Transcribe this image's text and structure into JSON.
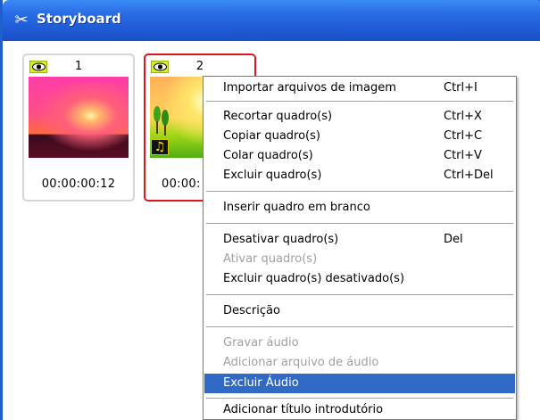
{
  "window": {
    "title": "Storyboard",
    "title_icon": "scissors-icon"
  },
  "frames": [
    {
      "number": "1",
      "time": "00:00:00:12",
      "selected": false,
      "has_audio": false
    },
    {
      "number": "2",
      "time": "00:00:",
      "selected": true,
      "has_audio": true
    }
  ],
  "menu": {
    "items": [
      {
        "label": "Importar arquivos de imagem",
        "shortcut": "Ctrl+I",
        "disabled": false,
        "highlighted": false
      },
      {
        "label": "Recortar quadro(s)",
        "shortcut": "Ctrl+X",
        "disabled": false,
        "highlighted": false
      },
      {
        "label": "Copiar quadro(s)",
        "shortcut": "Ctrl+C",
        "disabled": false,
        "highlighted": false
      },
      {
        "label": "Colar quadro(s)",
        "shortcut": "Ctrl+V",
        "disabled": false,
        "highlighted": false
      },
      {
        "label": "Excluir quadro(s)",
        "shortcut": "Ctrl+Del",
        "disabled": false,
        "highlighted": false
      },
      {
        "label": "Inserir quadro em branco",
        "shortcut": "",
        "disabled": false,
        "highlighted": false
      },
      {
        "label": "Desativar quadro(s)",
        "shortcut": "Del",
        "disabled": false,
        "highlighted": false
      },
      {
        "label": "Ativar quadro(s)",
        "shortcut": "",
        "disabled": true,
        "highlighted": false
      },
      {
        "label": "Excluir quadro(s) desativado(s)",
        "shortcut": "",
        "disabled": false,
        "highlighted": false
      },
      {
        "label": "Descrição",
        "shortcut": "",
        "disabled": false,
        "highlighted": false
      },
      {
        "label": "Gravar áudio",
        "shortcut": "",
        "disabled": true,
        "highlighted": false
      },
      {
        "label": "Adicionar arquivo de áudio",
        "shortcut": "",
        "disabled": true,
        "highlighted": false
      },
      {
        "label": "Excluir Áudio",
        "shortcut": "",
        "disabled": false,
        "highlighted": true
      },
      {
        "label": "Adicionar título introdutório",
        "shortcut": "",
        "disabled": false,
        "highlighted": false
      }
    ]
  },
  "colors": {
    "titlebar": "#2a6ee6",
    "selection_border": "#e0161e",
    "menu_highlight": "#316ac5",
    "visibility_badge": "#d9ef1e"
  }
}
